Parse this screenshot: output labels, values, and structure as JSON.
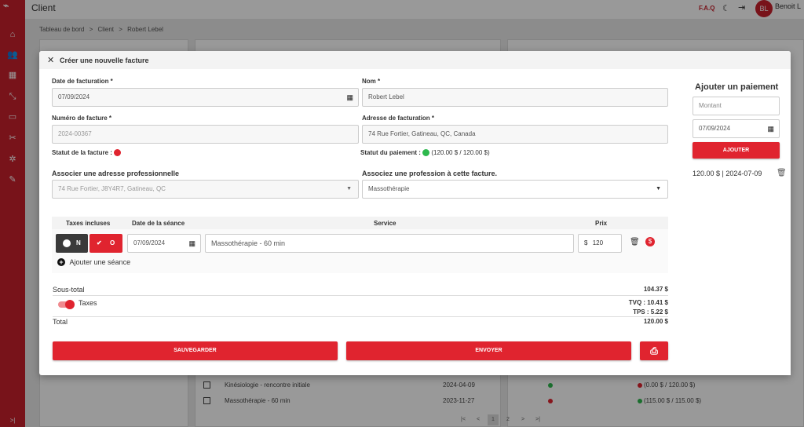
{
  "app": {
    "title": "Client",
    "faq": "F.A.Q",
    "user_initials": "BL",
    "user_name": "Benoit L"
  },
  "breadcrumb": [
    "Tableau de bord",
    ">",
    "Client",
    ">",
    "Robert Lebel"
  ],
  "background": {
    "rows": [
      {
        "service": "Kinésiologie - rencontre initiale",
        "date": "2024-04-09",
        "status": "(0.00 $ / 120.00 $)"
      },
      {
        "service": "Massothérapie - 60 min",
        "date": "2023-11-27",
        "status": "(115.00 $ / 115.00 $)"
      }
    ],
    "pager": [
      "|<",
      "<",
      "1",
      "2",
      ">",
      ">|"
    ]
  },
  "modal": {
    "title": "Créer une nouvelle facture",
    "date_label": "Date de facturation *",
    "date_value": "07/09/2024",
    "name_label": "Nom *",
    "name_value": "Robert Lebel",
    "invoice_num_label": "Numéro de facture *",
    "invoice_num_value": "2024-00367",
    "address_label": "Adresse de facturation *",
    "address_value": "74 Rue Fortier, Gatineau, QC, Canada",
    "invoice_status_label": "Statut de la facture :",
    "payment_status_label": "Statut du paiement :",
    "payment_status_value": "(120.00 $ / 120.00 $)",
    "pro_address_label": "Associer une adresse professionnelle",
    "pro_address_value": "74 Rue Fortier, J8Y4R7, Gatineau, QC",
    "profession_label": "Associez une profession à cette facture.",
    "profession_value": "Massothérapie",
    "sessions": {
      "headers": {
        "taxes": "Taxes incluses",
        "date": "Date de la séance",
        "service": "Service",
        "price": "Prix"
      },
      "row": {
        "no": "N",
        "yes": "O",
        "date": "07/09/2024",
        "service": "Massothérapie - 60 min",
        "currency": "$",
        "price": "120"
      },
      "add_label": "Ajouter une séance"
    },
    "totals": {
      "subtotal_label": "Sous-total",
      "subtotal_value": "104.37 $",
      "taxes_label": "Taxes",
      "tvq": "TVQ : 10.41 $",
      "tps": "TPS : 5.22 $",
      "total_label": "Total",
      "total_value": "120.00 $"
    },
    "buttons": {
      "save": "SAUVEGARDER",
      "send": "ENVOYER"
    },
    "payment": {
      "title": "Ajouter un paiement",
      "amount_placeholder": "Montant",
      "date_value": "07/09/2024",
      "add_button": "AJOUTER",
      "entry": "120.00 $ | 2024-07-09"
    }
  }
}
